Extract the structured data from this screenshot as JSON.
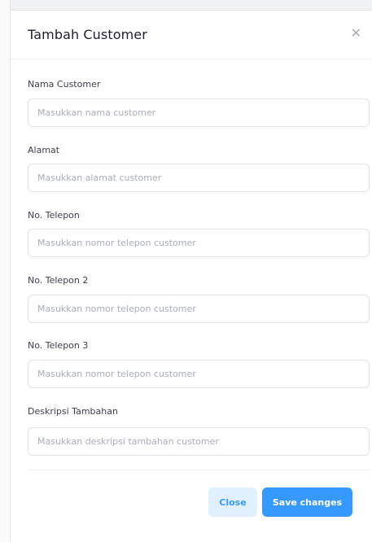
{
  "modal": {
    "title": "Tambah Customer",
    "close_icon": "close-icon"
  },
  "form": {
    "fields": [
      {
        "label": "Nama Customer",
        "placeholder": "Masukkan nama customer",
        "value": ""
      },
      {
        "label": "Alamat",
        "placeholder": "Masukkan alamat customer",
        "value": ""
      },
      {
        "label": "No. Telepon",
        "placeholder": "Masukkan nomor telepon customer",
        "value": ""
      },
      {
        "label": "No. Telepon 2",
        "placeholder": "Masukkan nomor telepon customer",
        "value": ""
      },
      {
        "label": "No. Telepon 3",
        "placeholder": "Masukkan nomor telepon customer",
        "value": ""
      },
      {
        "label": "Deskripsi Tambahan",
        "placeholder": "Masukkan deskripsi tambahan customer",
        "value": ""
      }
    ]
  },
  "footer": {
    "close_label": "Close",
    "save_label": "Save changes"
  },
  "colors": {
    "primary": "#3699ff",
    "primary_light": "#e1f0ff",
    "border": "#e1e3ea",
    "placeholder": "#a9adba"
  }
}
